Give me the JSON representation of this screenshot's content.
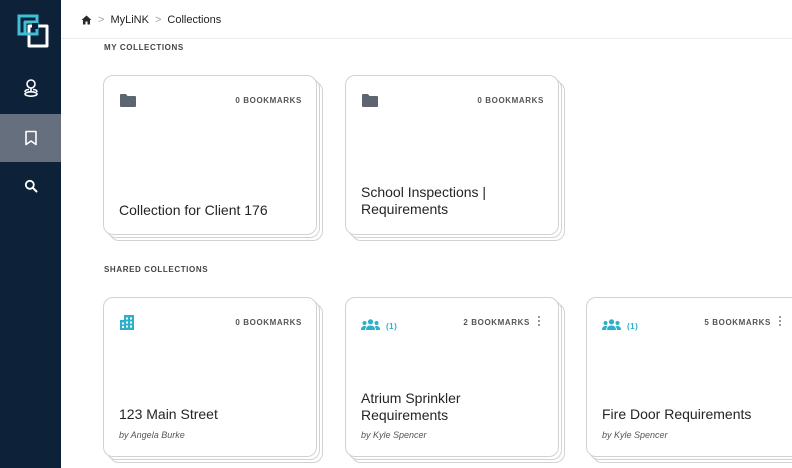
{
  "breadcrumb": {
    "items": [
      "MyLiNK",
      "Collections"
    ]
  },
  "sidebar": {
    "items": [
      {
        "icon": "user-pin-icon"
      },
      {
        "icon": "bookmark-icon",
        "active": true
      },
      {
        "icon": "search-icon"
      }
    ]
  },
  "my_collections": {
    "title": "MY COLLECTIONS",
    "cards": [
      {
        "icon": "folder-icon",
        "bookmarks": "0 BOOKMARKS",
        "title": "Collection for Client 176"
      },
      {
        "icon": "folder-icon",
        "bookmarks": "0 BOOKMARKS",
        "title": "School Inspections | Requirements"
      }
    ]
  },
  "shared_collections": {
    "title": "SHARED COLLECTIONS",
    "cards": [
      {
        "icon": "building-icon",
        "bookmarks": "0 BOOKMARKS",
        "title": "123 Main Street",
        "owner": "by Angela Burke"
      },
      {
        "icon": "group-icon",
        "members": "(1)",
        "bookmarks": "2 BOOKMARKS",
        "title": "Atrium Sprinkler Requirements",
        "owner": "by Kyle Spencer"
      },
      {
        "icon": "group-icon",
        "members": "(1)",
        "bookmarks": "5 BOOKMARKS",
        "title": "Fire Door Requirements",
        "owner": "by Kyle Spencer"
      }
    ]
  },
  "colors": {
    "sidebar": "#0d2238",
    "sidebar_active": "#666f7d",
    "accent": "#2bb0c8",
    "folder": "#5c6570"
  }
}
